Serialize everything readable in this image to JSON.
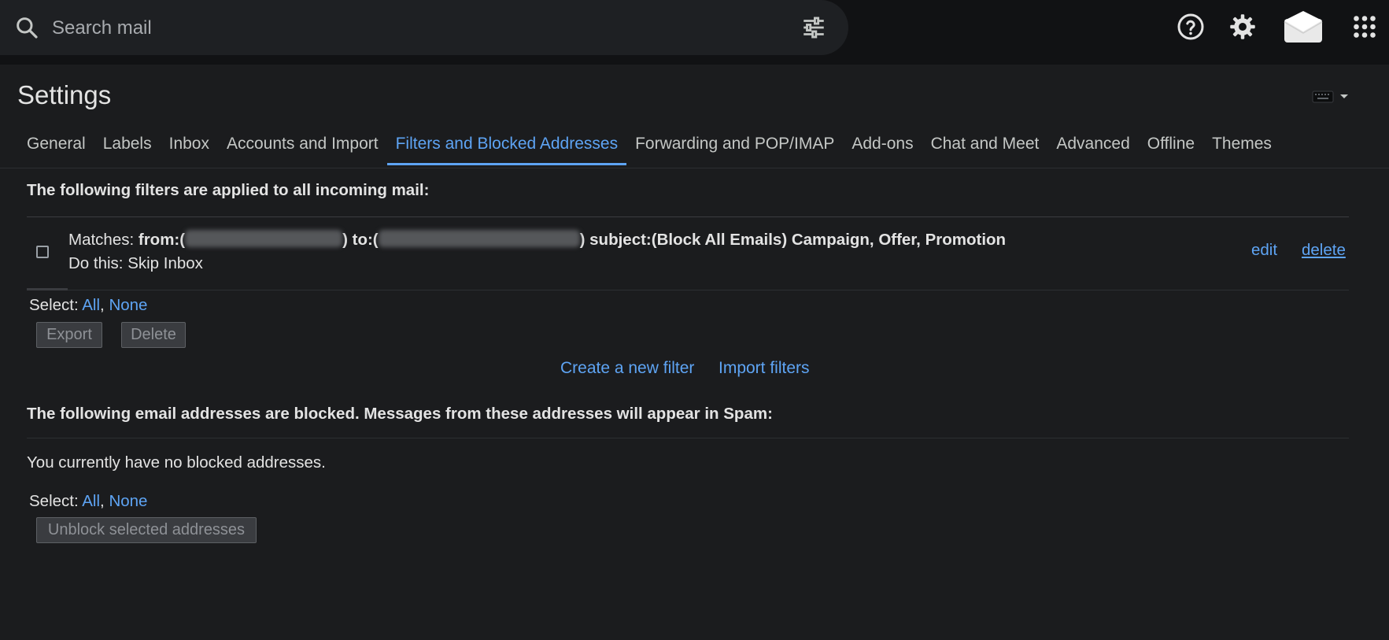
{
  "search": {
    "placeholder": "Search mail",
    "value": ""
  },
  "header_icons": [
    "help-icon",
    "settings-gear-icon",
    "account-avatar-icon",
    "apps-grid-icon"
  ],
  "settings": {
    "title": "Settings",
    "tabs": [
      "General",
      "Labels",
      "Inbox",
      "Accounts and Import",
      "Filters and Blocked Addresses",
      "Forwarding and POP/IMAP",
      "Add-ons",
      "Chat and Meet",
      "Advanced",
      "Offline",
      "Themes"
    ],
    "active_tab": "Filters and Blocked Addresses"
  },
  "filters": {
    "heading": "The following filters are applied to all incoming mail:",
    "rows": [
      {
        "matches_label": "Matches:",
        "from_open": "from:(",
        "to_open": ") to:(",
        "subject": ") subject:(Block All Emails) Campaign, Offer, Promotion",
        "action": "Do this: Skip Inbox",
        "edit": "edit",
        "delete": "delete"
      }
    ],
    "select_label": "Select:",
    "select_all": "All",
    "select_none": "None",
    "export_button": "Export",
    "delete_button": "Delete",
    "create_filter": "Create a new filter",
    "import_filters": "Import filters"
  },
  "blocked": {
    "heading": "The following email addresses are blocked. Messages from these addresses will appear in Spam:",
    "empty_message": "You currently have no blocked addresses.",
    "select_label": "Select:",
    "select_all": "All",
    "select_none": "None",
    "unblock_button": "Unblock selected addresses"
  },
  "colors": {
    "background": "#111214",
    "panel": "#1b1c1e",
    "accent_link": "#5ea4f4",
    "text": "#e3e3e3"
  }
}
